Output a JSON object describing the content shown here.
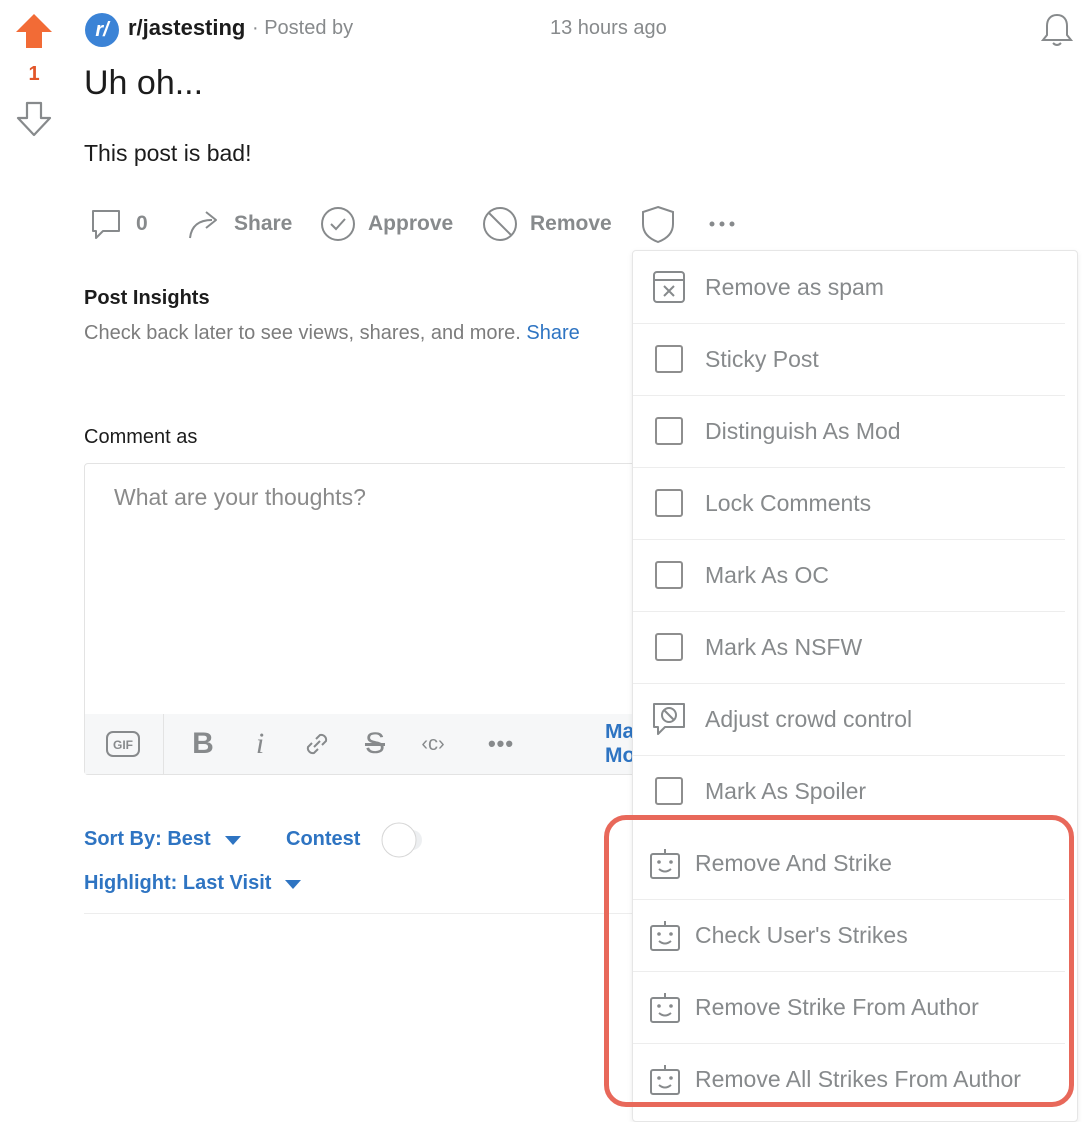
{
  "vote": {
    "count": "1"
  },
  "header": {
    "subreddit_avatar": "r/",
    "subreddit": "r/jastesting",
    "posted_by": "· Posted by",
    "time_ago": "13 hours ago"
  },
  "post": {
    "title": "Uh oh...",
    "body": "This post is bad!"
  },
  "actions": {
    "comments_count": "0",
    "share": "Share",
    "approve": "Approve",
    "remove": "Remove"
  },
  "insights": {
    "title": "Post Insights",
    "text": "Check back later to see views, shares, and more. ",
    "link": "Share"
  },
  "comment": {
    "label": "Comment as",
    "placeholder": "What are your thoughts?",
    "toolbar": {
      "gif": "GIF",
      "bold": "B",
      "italic": "i",
      "strike": "S",
      "code": "‹c›",
      "more": "•••",
      "markdown": "Markdown Mode"
    }
  },
  "sort": {
    "sort_by": "Sort By: Best",
    "contest": "Contest",
    "highlight": "Highlight: Last Visit"
  },
  "menu": {
    "items": [
      {
        "label": "Remove as spam",
        "icon": "spam-icon"
      },
      {
        "label": "Sticky Post",
        "icon": "checkbox"
      },
      {
        "label": "Distinguish As Mod",
        "icon": "checkbox"
      },
      {
        "label": "Lock Comments",
        "icon": "checkbox"
      },
      {
        "label": "Mark As OC",
        "icon": "checkbox"
      },
      {
        "label": "Mark As NSFW",
        "icon": "checkbox"
      },
      {
        "label": "Adjust crowd control",
        "icon": "crowd-control-icon"
      },
      {
        "label": "Mark As Spoiler",
        "icon": "checkbox"
      },
      {
        "label": "Remove And Strike",
        "icon": "robot-icon"
      },
      {
        "label": "Check User's Strikes",
        "icon": "robot-icon"
      },
      {
        "label": "Remove Strike From Author",
        "icon": "robot-icon"
      },
      {
        "label": "Remove All Strikes From Author",
        "icon": "robot-icon"
      }
    ]
  },
  "colors": {
    "upvote": "#f26b36",
    "link": "#2e74c2",
    "highlight_border": "#e8685a",
    "muted": "#878a8c"
  }
}
